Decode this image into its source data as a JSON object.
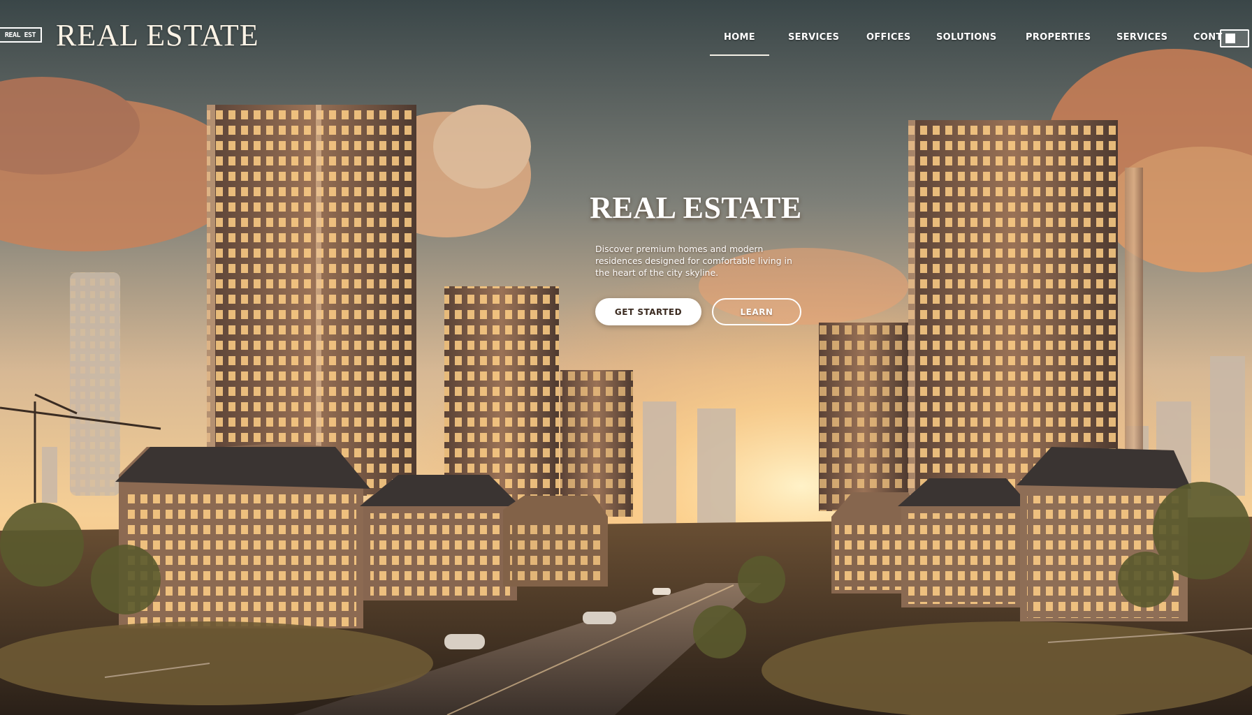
{
  "header": {
    "logo_mark_text": "REAL EST",
    "brand": "REAL ESTATE"
  },
  "nav": {
    "items": [
      {
        "label": "HOME",
        "active": true
      },
      {
        "label": "SERVICES",
        "active": false
      },
      {
        "label": "OFFICES",
        "active": false
      },
      {
        "label": "SOLUTIONS",
        "active": false
      },
      {
        "label": "PROPERTIES",
        "active": false
      },
      {
        "label": "SERVICES",
        "active": false
      },
      {
        "label": "CONT",
        "active": false
      }
    ]
  },
  "hero": {
    "title": "REAL ESTATE",
    "subtitle": "Discover premium homes and modern residences designed for comfortable living in the heart of the city skyline.",
    "primary_button": "GET STARTED",
    "secondary_button": "LEARN"
  },
  "colors": {
    "sky_top": "#3d4a4d",
    "sunset": "#f3c27a",
    "cloud": "#d58a5a",
    "tower": "#7a5a45",
    "window_glow": "#ffd28a"
  }
}
